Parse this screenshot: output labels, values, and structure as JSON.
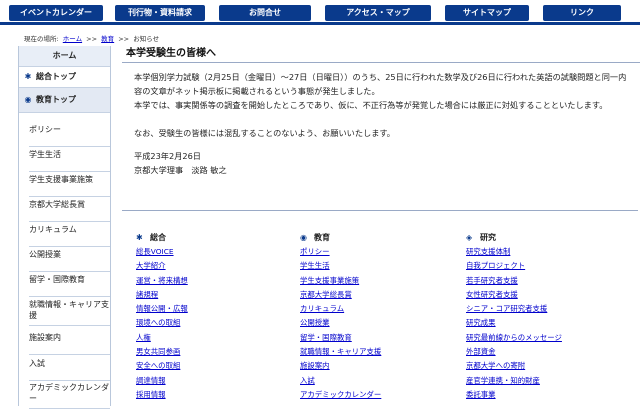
{
  "topnav": {
    "tabs": [
      {
        "label": "イベントカレンダー"
      },
      {
        "label": "刊行物・資料請求"
      },
      {
        "label": "お問合せ"
      },
      {
        "label": "アクセス・マップ"
      },
      {
        "label": "サイトマップ"
      },
      {
        "label": "リンク"
      }
    ]
  },
  "breadcrumb": {
    "prefix": "現在の場所:",
    "items": [
      "ホーム",
      "教育",
      "お知らせ"
    ],
    "separator": ">>"
  },
  "sidebar": {
    "home": "ホーム",
    "sogo_top": "総合トップ",
    "kyoiku_top": "教育トップ",
    "items": [
      {
        "label": "ポリシー"
      },
      {
        "label": "学生生活"
      },
      {
        "label": "学生支援事業施策"
      },
      {
        "label": "京都大学総長賞"
      },
      {
        "label": "カリキュラム"
      },
      {
        "label": "公開授業"
      },
      {
        "label": "留学・国際教育"
      },
      {
        "label": "就職情報・キャリア支援"
      },
      {
        "label": "施設案内"
      },
      {
        "label": "入試"
      },
      {
        "label": "アカデミックカレンダー"
      }
    ]
  },
  "article": {
    "title": "本学受験生の皆様へ",
    "p1": "本学個別学力試験（2月25日（金曜日）～27日（日曜日））のうち、25日に行われた数学及び26日に行われた英語の試験問題と同一内容の文章がネット掲示板に掲載されるという事態が発生しました。",
    "p2": "本学では、事実関係等の調査を開始したところであり、仮に、不正行為等が発覚した場合には厳正に対処することといたします。",
    "p3": "なお、受験生の皆様には混乱することのないよう、お願いいたします。",
    "date": "平成23年2月26日",
    "signature": "京都大学理事　淡路 敏之"
  },
  "bottom": {
    "columns": [
      {
        "heading": "総合",
        "icon": "asterisk-icon",
        "items": [
          "総長VOICE",
          "大学紹介",
          "運営・将来構想",
          "諸規程",
          "情報公開・広報",
          "環境への取組",
          "人権",
          "男女共同参画",
          "安全への取組",
          "調達情報",
          "採用情報"
        ]
      },
      {
        "heading": "教育",
        "icon": "circle-icon",
        "items": [
          "ポリシー",
          "学生生活",
          "学生支援事業施策",
          "京都大学総長賞",
          "カリキュラム",
          "公開授業",
          "留学・国際教育",
          "就職情報・キャリア支援",
          "施設案内",
          "入試",
          "アカデミックカレンダー"
        ]
      },
      {
        "heading": "研究",
        "icon": "diamond-icon",
        "items": [
          "研究支援体制",
          "自我プロジェクト",
          "若手研究者支援",
          "女性研究者支援",
          "シニア・コア研究者支援",
          "研究成果",
          "研究最前線からのメッセージ",
          "外部資金",
          "京都大学への寄附",
          "産官学連携・知的財産",
          "委託事業"
        ]
      }
    ]
  },
  "colors": {
    "nav_bg": "#0a3a8c",
    "link": "#0000cc"
  }
}
